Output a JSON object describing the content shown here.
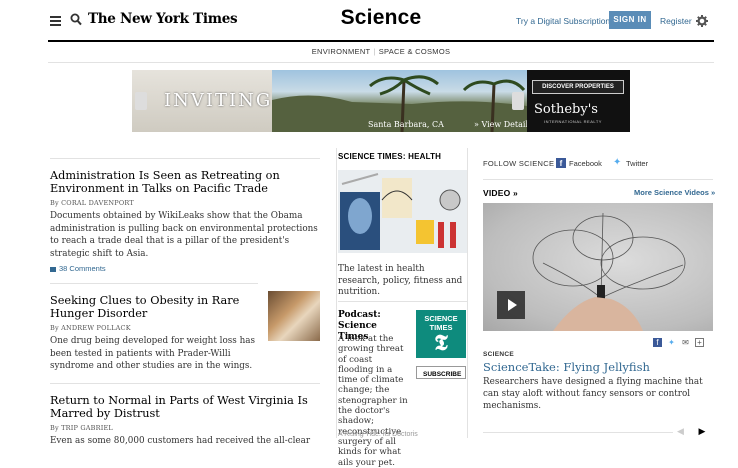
{
  "header": {
    "logo": "The New York Times",
    "section_title": "Science",
    "subscribe_link": "Try a Digital Subscription",
    "signin_label": "SIGN IN",
    "register_link": "Register"
  },
  "subnav": {
    "items": [
      "ENVIRONMENT",
      "SPACE & COSMOS"
    ]
  },
  "ad": {
    "headline": "INVITING",
    "location": "Santa Barbara, CA",
    "view_label": "» View Details",
    "cta": "DISCOVER PROPERTIES",
    "brand": "Sotheby's",
    "brand_sub": "INTERNATIONAL REALTY"
  },
  "stories": [
    {
      "headline": "Administration Is Seen as Retreating on Environment in Talks on Pacific Trade",
      "byline": "By CORAL DAVENPORT",
      "summary": "Documents obtained by WikiLeaks show that the Obama administration is pulling back on environmental protections to reach a trade deal that is a pillar of the president's strategic shift to Asia.",
      "comments": "38 Comments"
    },
    {
      "headline": "Seeking Clues to Obesity in Rare Hunger Disorder",
      "byline": "By ANDREW POLLACK",
      "summary": "One drug being developed for weight loss has been tested in patients with Prader-Willi syndrome and other studies are in the wings."
    },
    {
      "headline": "Return to Normal in Parts of West Virginia Is Marred by Distrust",
      "byline": "By TRIP GABRIEL",
      "summary": "Even as some 80,000 customers had received the all-clear"
    }
  ],
  "science_times": {
    "heading": "SCIENCE TIMES: HEALTH",
    "description": "The latest in health research, policy, fitness and nutrition.",
    "podcast_title": "Podcast: Science Times",
    "podcast_desc": "A look at the growing threat of coast flooding in a time of climate change; the stenographer in the doctor's shadow; reconstructive surgery of all kinds for what ails your pet.",
    "logo_text": "SCIENCE TIMES",
    "subscribe_label": "SUBSCRIBE",
    "cut_text": "A Rising Tide. Its Doctoris"
  },
  "follow": {
    "label": "FOLLOW SCIENCE",
    "facebook": "Facebook",
    "twitter": "Twitter"
  },
  "video": {
    "label": "VIDEO »",
    "more_label": "More Science Videos »",
    "kicker": "SCIENCE",
    "title": "ScienceTake: Flying Jellyfish",
    "description": "Researchers have designed a flying machine that can stay aloft without fancy sensors or control mechanisms."
  },
  "icons": {
    "facebook_color": "#3b5998",
    "twitter_color": "#55acee",
    "link_color": "#326891",
    "signin_color": "#5a8cb7"
  }
}
